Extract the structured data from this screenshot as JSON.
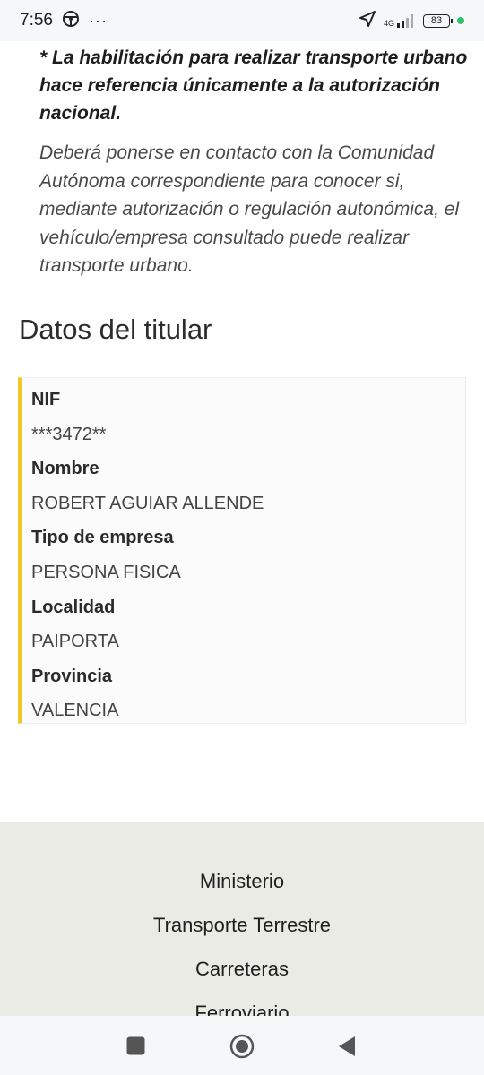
{
  "status_bar": {
    "time": "7:56",
    "overflow": "···",
    "network": "4G",
    "battery": "83"
  },
  "notes": {
    "bold": "* La habilitación para realizar transporte urbano hace referencia únicamente a la autorización nacional.",
    "italic": "Deberá ponerse en contacto con la Comunidad Autónoma correspondiente para conocer si, mediante autorización o regulación autonómica, el vehículo/empresa consultado puede realizar transporte urbano."
  },
  "section_title": "Datos del titular",
  "details": [
    {
      "label": "NIF",
      "value": "***3472**"
    },
    {
      "label": "Nombre",
      "value": "ROBERT AGUIAR ALLENDE"
    },
    {
      "label": "Tipo de empresa",
      "value": "PERSONA FISICA"
    },
    {
      "label": "Localidad",
      "value": "PAIPORTA"
    },
    {
      "label": "Provincia",
      "value": "VALENCIA"
    }
  ],
  "footer_links": [
    "Ministerio",
    "Transporte Terrestre",
    "Carreteras",
    "Ferroviario"
  ],
  "colors": {
    "accent": "#f0c929",
    "footer_bg": "#ebebe5",
    "status_green": "#2fc26a"
  },
  "icons": [
    "steering-wheel-icon",
    "location-arrow-icon",
    "signal-icon",
    "battery-icon",
    "recent-apps-icon",
    "home-icon",
    "back-icon"
  ]
}
